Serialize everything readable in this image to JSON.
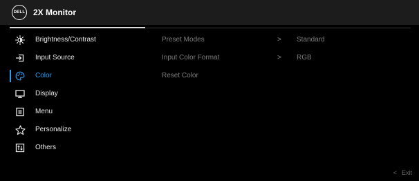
{
  "header": {
    "logo_text": "DELL",
    "title": "2X Monitor"
  },
  "sidebar": {
    "items": [
      {
        "label": "Brightness/Contrast",
        "icon": "brightness-icon",
        "active": false
      },
      {
        "label": "Input Source",
        "icon": "input-source-icon",
        "active": false
      },
      {
        "label": "Color",
        "icon": "color-palette-icon",
        "active": true
      },
      {
        "label": "Display",
        "icon": "display-monitor-icon",
        "active": false
      },
      {
        "label": "Menu",
        "icon": "menu-list-icon",
        "active": false
      },
      {
        "label": "Personalize",
        "icon": "star-icon",
        "active": false
      },
      {
        "label": "Others",
        "icon": "others-icon",
        "active": false
      }
    ]
  },
  "submenu": {
    "rows": [
      {
        "label": "Preset Modes",
        "arrow": ">",
        "value": "Standard"
      },
      {
        "label": "Input Color Format",
        "arrow": ">",
        "value": "RGB"
      },
      {
        "label": "Reset Color",
        "arrow": "",
        "value": ""
      }
    ]
  },
  "footer": {
    "exit_arrow": "<",
    "exit_label": "Exit"
  },
  "colors": {
    "accent": "#2a9df4",
    "background": "#000000",
    "titlebar": "#1c1c1c"
  }
}
